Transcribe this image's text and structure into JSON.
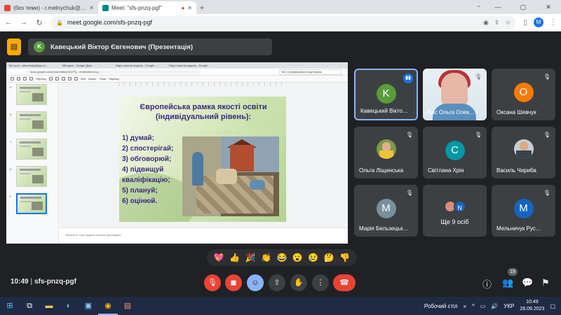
{
  "browser": {
    "tabs": [
      {
        "title": "(без теми) - r.melnychuk@ipp…",
        "color": "#ea4335"
      },
      {
        "title": "Meet: \"sfs-pnzq-pgf\"",
        "color": "#00897b",
        "active": true
      }
    ],
    "new_tab": "+",
    "window_controls": [
      "—",
      "▢",
      "✕"
    ],
    "url": "meet.google.com/sfs-pnzq-pgf",
    "profile_initial": "M"
  },
  "presenter": {
    "initial": "K",
    "label": "Кавецький Віктор Євгенович (Презентація)"
  },
  "shared_screen": {
    "tabs": [
      "Всі гості - vikavetsky@ippo.k…",
      "Мій диск - Google Диск",
      "Євро освітня модель - Google …",
      "Євро освітня модель - Google …"
    ],
    "url": "docs.google.com/presentation/d/1FKj…/edit#slide=id.g…",
    "notice": "Ви є в режимі демонстрації екрана",
    "menu": [
      "Перехід",
      "Фон",
      "Макет",
      "Тема",
      "Перехід"
    ],
    "thumb_numbers": [
      "5",
      "6",
      "7",
      "8",
      "9"
    ],
    "speaker_notes": "Натисніть, щоб додати нотатки доповідача"
  },
  "slide": {
    "title_line1": "Європейська рамка якості освіти",
    "title_line2": "(індивідуальний рівень):",
    "items": [
      "1)  думай;",
      "2)  спостерігай;",
      "3)  обговорюй;",
      "4)  підвищуй",
      "  кваліфікацію;",
      "5)  плануй;",
      "6)  оцінюй."
    ]
  },
  "participants": [
    {
      "name": "Кавецький Вікто…",
      "initial": "K",
      "color": "#5a9b3c"
    },
    {
      "name": "Бас Ольга Олек…",
      "photo": true
    },
    {
      "name": "Оксана Шевчук",
      "initial": "O",
      "color": "#f57c00"
    },
    {
      "name": "Ольга Ліщинська",
      "photo": true
    },
    {
      "name": "Світлана Хрін",
      "initial": "С",
      "color": "#0097a7"
    },
    {
      "name": "Василь Чириба",
      "photo": true
    },
    {
      "name": "Марія Бельзецьк…",
      "initial": "M",
      "color": "#78909c"
    },
    {
      "name": "Ще 9 осіб",
      "initial": "N",
      "color": "#1565c0"
    },
    {
      "name": "Мельничук Рус…",
      "initial": "M",
      "color": "#1565c0"
    }
  ],
  "reactions": [
    "💖",
    "👍",
    "🎉",
    "👏",
    "😂",
    "😮",
    "😢",
    "🤔",
    "👎"
  ],
  "controls": {
    "meeting_time": "10:49",
    "meeting_code": "sfs-pnzq-pgf",
    "people_count": "19"
  },
  "taskbar": {
    "desktop_label": "Робочий стіл",
    "language": "УКР",
    "time": "10:49",
    "date": "28.09.2023"
  }
}
